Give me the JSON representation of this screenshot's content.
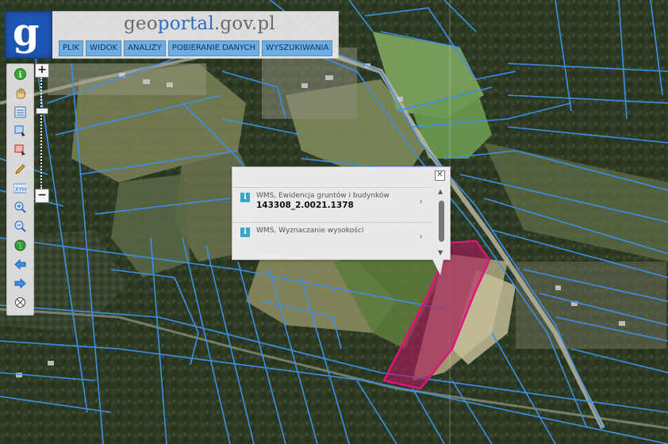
{
  "header": {
    "logo_letter": "g",
    "title_part1": "geo",
    "title_part2": "portal",
    "title_part3": ".gov.pl"
  },
  "menu": [
    {
      "label": "PLIK"
    },
    {
      "label": "WIDOK"
    },
    {
      "label": "ANALIZY"
    },
    {
      "label": "POBIERANIE DANYCH"
    },
    {
      "label": "WYSZUKIWANIA"
    }
  ],
  "toolbar": [
    {
      "icon": "info-icon"
    },
    {
      "icon": "pan-hand-icon"
    },
    {
      "icon": "layers-icon"
    },
    {
      "icon": "select-area-icon"
    },
    {
      "icon": "select-red-icon"
    },
    {
      "icon": "pencil-icon"
    },
    {
      "icon": "xyh-coordinates-icon",
      "label": "XYH"
    },
    {
      "icon": "zoom-in-icon"
    },
    {
      "icon": "zoom-out-icon"
    },
    {
      "icon": "globe-icon"
    },
    {
      "icon": "back-arrow-icon"
    },
    {
      "icon": "forward-arrow-icon"
    },
    {
      "icon": "crosshair-icon"
    }
  ],
  "zoom": {
    "plus": "+",
    "minus": "−"
  },
  "popup": {
    "close": "✕",
    "rows": [
      {
        "label": "WMS, Ewidencja gruntów i budynków",
        "value": "143308_2.0021.1378"
      },
      {
        "label": "WMS, Wyznaczanie wysokości",
        "value": ""
      }
    ]
  },
  "colors": {
    "parcel_lines": "#3d8ee8",
    "highlight_fill": "#b0195e",
    "highlight_stroke": "#e0157a",
    "logo_bg": "#1f56b3",
    "menu_bg": "#6faee3"
  }
}
